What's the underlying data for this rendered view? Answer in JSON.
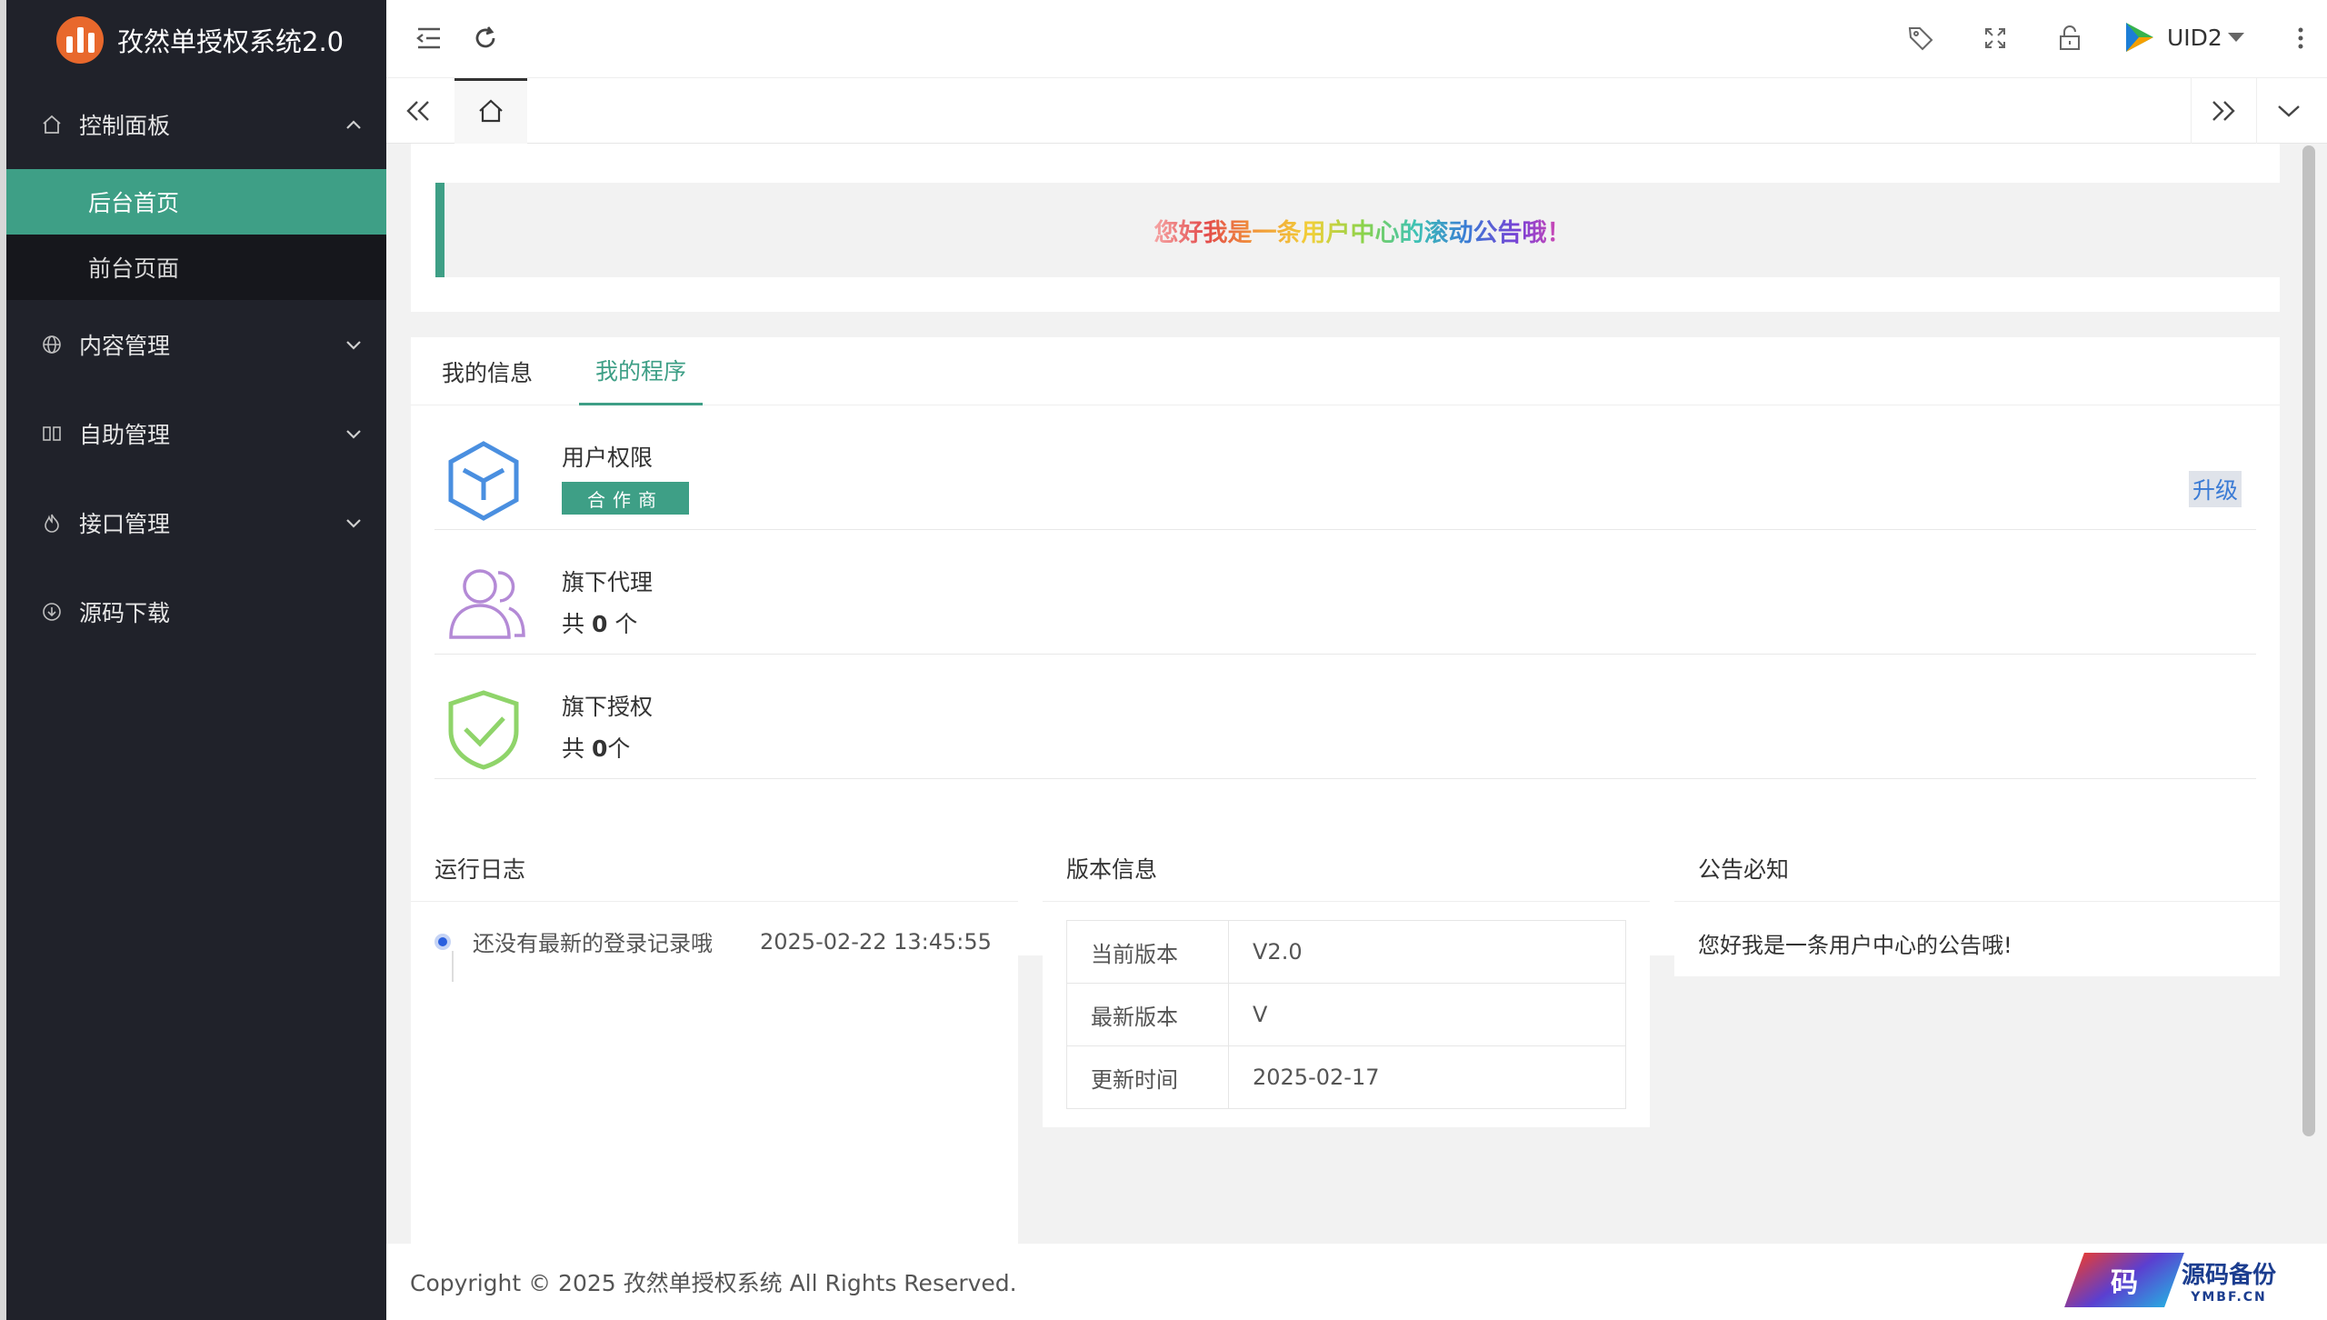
{
  "app": {
    "title": "孜然单授权系统2.0"
  },
  "sidebar": {
    "items": [
      {
        "label": "控制面板",
        "icon": "home-icon",
        "expanded": true,
        "children": [
          {
            "label": "后台首页",
            "active": true
          },
          {
            "label": "前台页面"
          }
        ]
      },
      {
        "label": "内容管理",
        "icon": "globe-icon"
      },
      {
        "label": "自助管理",
        "icon": "columns-icon"
      },
      {
        "label": "接口管理",
        "icon": "fire-icon"
      },
      {
        "label": "源码下载",
        "icon": "download-icon"
      }
    ]
  },
  "header": {
    "username": "UID2",
    "icons": [
      "menu-fold-icon",
      "refresh-icon",
      "tag-icon",
      "fullscreen-icon",
      "lock-icon",
      "more-icon"
    ]
  },
  "tabbar": {
    "icons": [
      "double-left-icon",
      "home-icon",
      "double-right-icon",
      "chevron-down-icon"
    ]
  },
  "notice": {
    "text": "您好我是一条用户中心的滚动公告哦！"
  },
  "program_card": {
    "tabs": [
      {
        "label": "我的信息"
      },
      {
        "label": "我的程序",
        "active": true
      }
    ],
    "rows": [
      {
        "title": "用户权限",
        "badge": "合作商",
        "action": "升级",
        "icon": "cube-icon"
      },
      {
        "title": "旗下代理",
        "prefix": "共",
        "count": "0",
        "suffix": "个",
        "icon": "users-icon"
      },
      {
        "title": "旗下授权",
        "prefix": "共",
        "count": "0",
        "suffix": "个",
        "icon": "shield-check-icon"
      }
    ]
  },
  "log_card": {
    "title": "运行日志",
    "entries": [
      {
        "text": "还没有最新的登录记录哦",
        "time": "2025-02-22 13:45:55"
      }
    ]
  },
  "version_card": {
    "title": "版本信息",
    "rows": [
      {
        "key": "当前版本",
        "value": "V2.0"
      },
      {
        "key": "最新版本",
        "value": "V"
      },
      {
        "key": "更新时间",
        "value": "2025-02-17"
      }
    ]
  },
  "announce_card": {
    "title": "公告必知",
    "text": "您好我是一条用户中心的公告哦!"
  },
  "footer": {
    "text": "Copyright © 2025 孜然单授权系统 All Rights Reserved."
  },
  "watermark": {
    "logo_char": "码",
    "big": "源码备份",
    "small": "YMBF.CN"
  },
  "colors": {
    "sidebar_bg": "#20222a",
    "accent": "#3e9f86",
    "link": "#3a7bd5"
  }
}
